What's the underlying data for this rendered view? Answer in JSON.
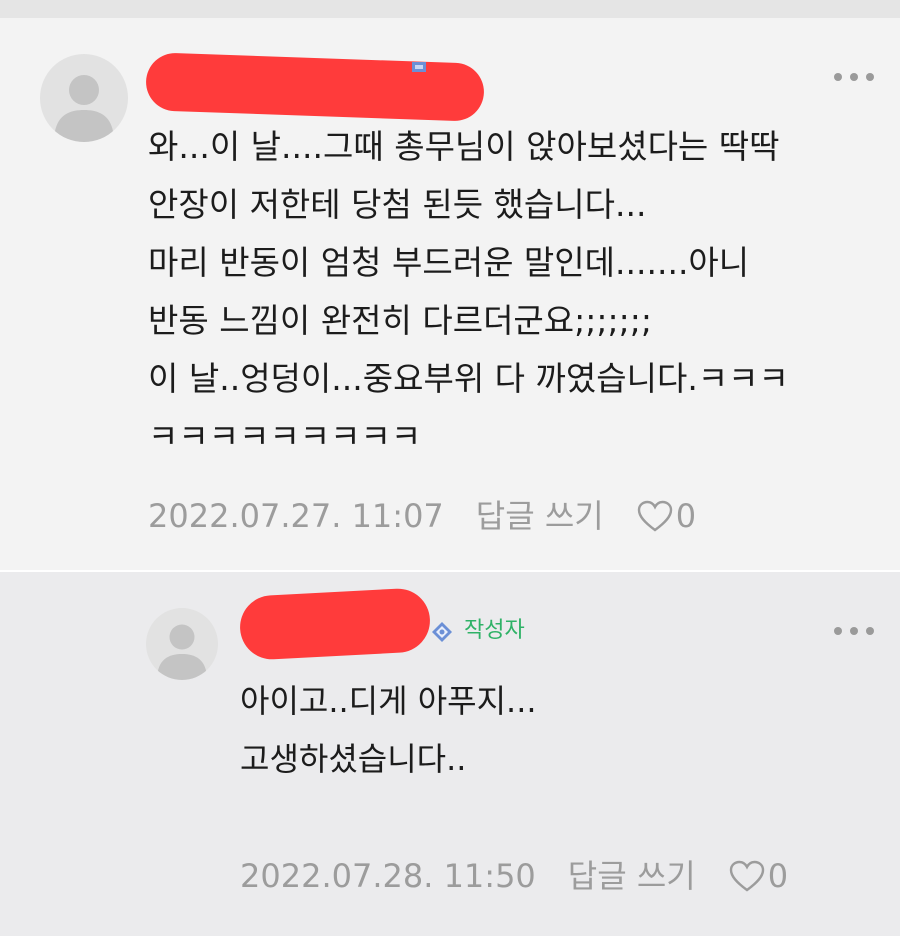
{
  "comments": [
    {
      "lines": [
        "와...이 날....그때 총무님이 앉아보셨다는 딱딱",
        "안장이 저한테 당첨 된듯 했습니다...",
        "마리 반동이 엄청 부드러운 말인데.......아니",
        "반동 느낌이 완전히 다르더군요;;;;;;;",
        "이 날..엉덩이...중요부위 다 까였습니다.ㅋㅋㅋ",
        "ㅋㅋㅋㅋㅋㅋㅋㅋㅋ"
      ],
      "date": "2022.07.27. 11:07",
      "reply_label": "답글 쓰기",
      "likes": "0"
    },
    {
      "author_tag": "작성자",
      "lines": [
        "아이고..디게 아푸지...",
        "고생하셨습니다.."
      ],
      "date": "2022.07.28. 11:50",
      "reply_label": "답글 쓰기",
      "likes": "0"
    }
  ],
  "colors": {
    "redaction": "#ff3b3b",
    "author_tag": "#2fb267",
    "meta_text": "#9c9c9c"
  },
  "icons": [
    "avatar-placeholder-icon",
    "more-options-icon",
    "heart-icon",
    "member-grade-icon"
  ]
}
